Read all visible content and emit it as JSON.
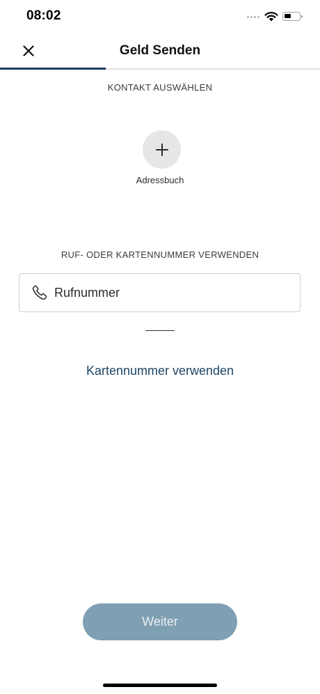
{
  "status_bar": {
    "time": "08:02",
    "icons": [
      "signal-dots-icon",
      "wifi-icon",
      "battery-icon"
    ]
  },
  "header": {
    "title": "Geld Senden",
    "close_icon": "close-icon",
    "step_progress": 0.33
  },
  "contact_section": {
    "heading": "KONTAKT AUSWÄHLEN",
    "address_book": {
      "icon": "plus-icon",
      "label": "Adressbuch"
    }
  },
  "number_section": {
    "heading": "RUF- ODER KARTENNUMMER VERWENDEN",
    "phone_field": {
      "icon": "phone-icon",
      "placeholder": "Rufnummer",
      "value": ""
    },
    "card_link": "Kartennummer verwenden"
  },
  "footer": {
    "continue_label": "Weiter"
  },
  "colors": {
    "accent": "#1c3b5e",
    "link": "#1d4566",
    "button_disabled": "#7fa0b3",
    "icon_circle": "#e6e6e6"
  }
}
